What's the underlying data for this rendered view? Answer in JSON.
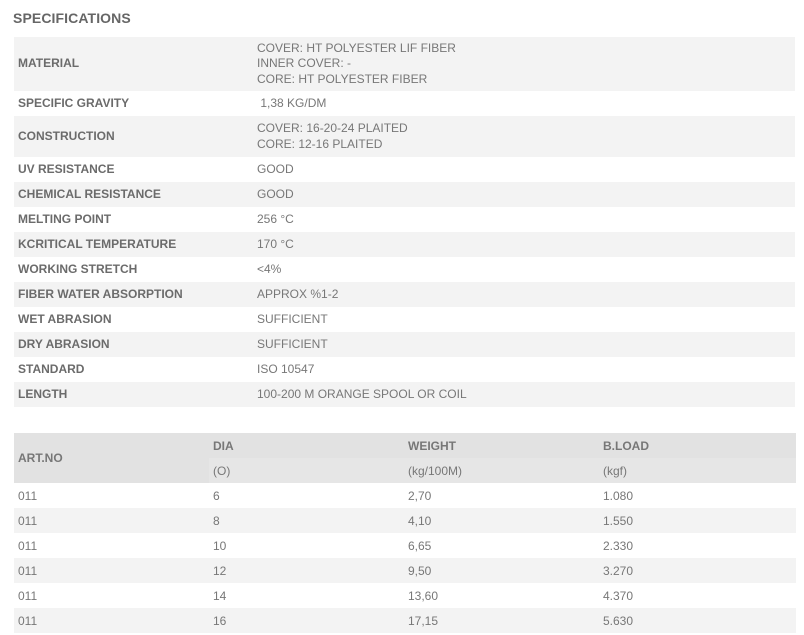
{
  "title": "SPECIFICATIONS",
  "specs": [
    {
      "label": "MATERIAL",
      "lines": [
        "COVER: HT POLYESTER LIF FIBER",
        "INNER COVER: -",
        "CORE: HT POLYESTER FIBER"
      ]
    },
    {
      "label": "SPECIFIC GRAVITY",
      "lines": [
        " 1,38 KG/DM"
      ]
    },
    {
      "label": "CONSTRUCTION",
      "lines": [
        "COVER: 16-20-24 PLAITED",
        "CORE: 12-16 PLAITED"
      ]
    },
    {
      "label": "UV RESISTANCE",
      "lines": [
        "GOOD"
      ]
    },
    {
      "label": "CHEMICAL RESISTANCE",
      "lines": [
        "GOOD"
      ]
    },
    {
      "label": "MELTING POINT",
      "lines": [
        "256 °C"
      ]
    },
    {
      "label": "KCRITICAL TEMPERATURE",
      "lines": [
        "170 °C"
      ]
    },
    {
      "label": "WORKING STRETCH",
      "lines": [
        "<4%"
      ]
    },
    {
      "label": "FIBER WATER ABSORPTION",
      "lines": [
        "APPROX %1-2"
      ]
    },
    {
      "label": "WET ABRASION",
      "lines": [
        "SUFFICIENT"
      ]
    },
    {
      "label": "DRY ABRASION",
      "lines": [
        "SUFFICIENT"
      ]
    },
    {
      "label": "STANDARD",
      "lines": [
        "ISO 10547"
      ]
    },
    {
      "label": "LENGTH",
      "lines": [
        "100-200 M ORANGE SPOOL OR COIL"
      ]
    }
  ],
  "products": {
    "headers": {
      "art_no": "ART.NO",
      "dia": "DIA",
      "dia_unit": "(O)",
      "weight": "WEIGHT",
      "weight_unit": "(kg/100M)",
      "bload": "B.LOAD",
      "bload_unit": "(kgf)"
    },
    "rows": [
      [
        "011",
        "6",
        "2,70",
        "1.080"
      ],
      [
        "011",
        "8",
        "4,10",
        "1.550"
      ],
      [
        "011",
        "10",
        "6,65",
        "2.330"
      ],
      [
        "011",
        "12",
        "9,50",
        "3.270"
      ],
      [
        "011",
        "14",
        "13,60",
        "4.370"
      ],
      [
        "011",
        "16",
        "17,15",
        "5.630"
      ]
    ]
  }
}
